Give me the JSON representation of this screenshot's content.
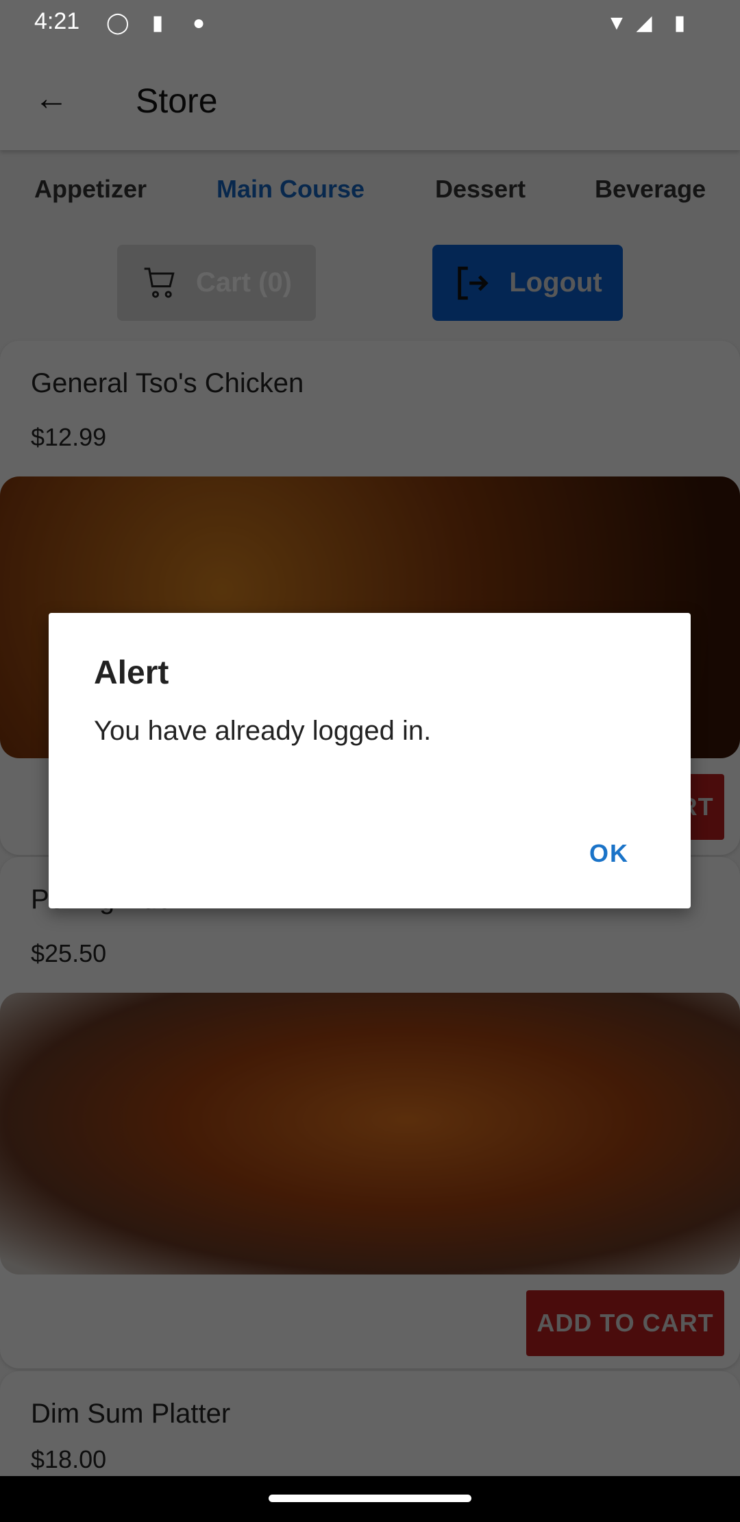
{
  "status_bar": {
    "time": "4:21",
    "icons": [
      "shield-icon",
      "sd-card-icon",
      "cat-icon",
      "wifi-icon",
      "signal-icon",
      "battery-icon"
    ]
  },
  "app_bar": {
    "title": "Store",
    "back_icon": "arrow-left-icon"
  },
  "tabs": [
    {
      "label": "Appetizer",
      "active": false
    },
    {
      "label": "Main Course",
      "active": true
    },
    {
      "label": "Dessert",
      "active": false
    },
    {
      "label": "Beverage",
      "active": false
    }
  ],
  "actions": {
    "cart_label": "Cart (0)",
    "logout_label": "Logout"
  },
  "products": [
    {
      "name": "General Tso's Chicken",
      "price": "$12.99",
      "button": "ADD TO CART"
    },
    {
      "name": "Peking Duck",
      "price": "$25.50",
      "button": "ADD TO CART"
    },
    {
      "name": "Dim Sum Platter",
      "price": "$18.00"
    }
  ],
  "dialog": {
    "title": "Alert",
    "message": "You have already logged in.",
    "ok_label": "OK"
  },
  "colors": {
    "accent": "#1565c0",
    "add_to_cart": "#b81d1d",
    "logout": "#0a5fd0"
  }
}
